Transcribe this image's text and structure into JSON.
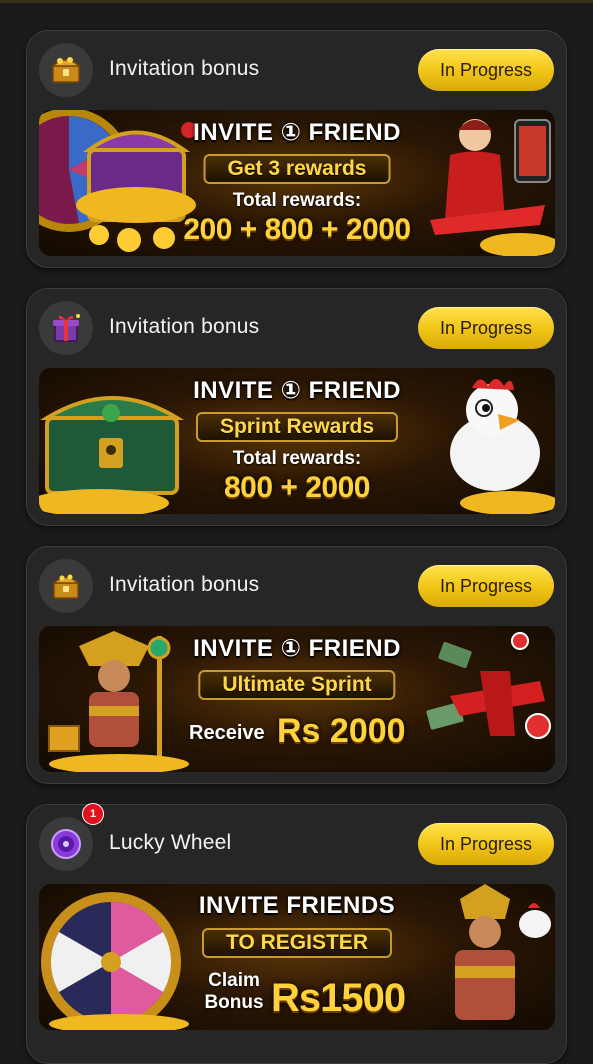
{
  "colors": {
    "page_bg": "#1b1b1b",
    "card_bg": "#262626",
    "button_yellow": "#f0c416",
    "badge_red": "#e0101c",
    "banner_gold": "#ffd23c"
  },
  "cards": [
    {
      "icon": "treasure-chest-icon",
      "title": "Invitation bonus",
      "status": "In Progress",
      "banner": {
        "line1": "INVITE ① FRIEND",
        "pill": "Get 3 rewards",
        "line3": "Total rewards:",
        "line4": "200 + 800 + 2000"
      }
    },
    {
      "icon": "gift-box-icon",
      "title": "Invitation bonus",
      "status": "In Progress",
      "banner": {
        "line1": "INVITE ① FRIEND",
        "pill": "Sprint Rewards",
        "line3": "Total rewards:",
        "line4": "800 + 2000"
      }
    },
    {
      "icon": "treasure-chest-icon",
      "title": "Invitation bonus",
      "status": "In Progress",
      "banner": {
        "line1": "INVITE ① FRIEND",
        "pill": "Ultimate Sprint",
        "receive": "Receive",
        "amount": "Rs 2000"
      }
    },
    {
      "icon": "lucky-wheel-icon",
      "title": "Lucky Wheel",
      "status": "In Progress",
      "badge": "1",
      "banner": {
        "line1": "INVITE FRIENDS",
        "pill": "TO REGISTER",
        "claim": "Claim Bonus",
        "amount": "Rs1500"
      }
    }
  ]
}
